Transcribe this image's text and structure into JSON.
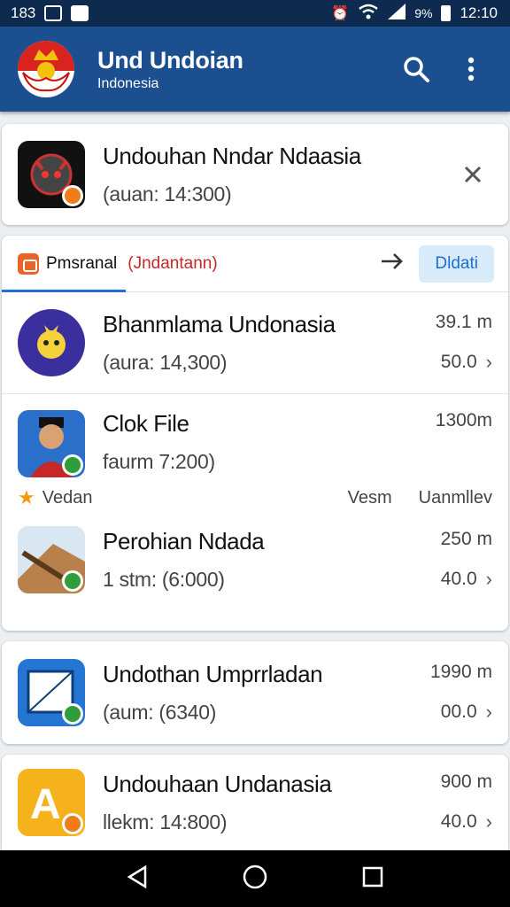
{
  "status_bar": {
    "time_left": "183",
    "battery": "9%",
    "clock": "12:10"
  },
  "app_bar": {
    "title": "Und Undoian",
    "subtitle": "Indonesia"
  },
  "top_card": {
    "name": "Undouhan Nndar Ndaasia",
    "sub": "(auan: 14:300)"
  },
  "tabs": {
    "label": "Pmsranal",
    "red_label": "(Jndantann)",
    "detail_button": "Dldati"
  },
  "items": [
    {
      "name": "Bhanmlama Undonasia",
      "sub": "(aura: 14,300)",
      "size": "39.1 m",
      "value": "50.0"
    },
    {
      "name": "Clok File",
      "sub": "faurm 7:200)",
      "size": "1300m",
      "meta_star": "Vedan",
      "meta_mid": "Vesm",
      "meta_right": "Uanmllev"
    },
    {
      "name": "Perohian Ndada",
      "sub": "1 stm: (6:000)",
      "size": "250 m",
      "value": "40.0"
    },
    {
      "name": "Undothan Umprrladan",
      "sub": "(aum: (6340)",
      "size": "1990 m",
      "value": "00.0"
    },
    {
      "name": "Undouhaan Undanasia",
      "sub": "llekm: 14:800)",
      "size": "900 m",
      "value": "40.0"
    }
  ],
  "icons": {
    "search": "search-icon",
    "more": "more-vert-icon",
    "close": "close-icon",
    "arrow": "arrow-right-icon",
    "chevron": "chevron-right-icon"
  },
  "colors": {
    "appbar": "#1b4f8f",
    "statusbar": "#0e2a4f",
    "accent": "#1e6fd9"
  }
}
